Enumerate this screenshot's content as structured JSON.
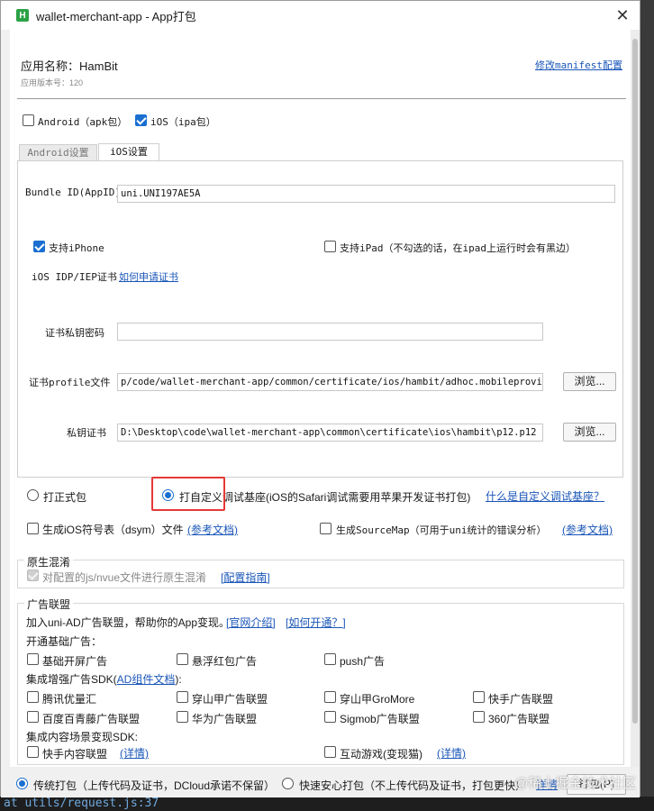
{
  "window": {
    "title": "wallet-merchant-app - App打包",
    "logo": "H"
  },
  "app": {
    "name_label": "应用名称：HamBit",
    "version_label": "应用版本号：120",
    "edit_manifest": "修改manifest配置"
  },
  "platforms": {
    "android": {
      "label": "Android（apk包）",
      "checked": false
    },
    "ios": {
      "label": "iOS（ipa包）",
      "checked": true
    }
  },
  "tabs": [
    "Android设置",
    "iOS设置"
  ],
  "ios": {
    "bundle_label": "Bundle ID(AppID)",
    "bundle_value": "uni.UNI197AE5A",
    "support_iphone": "支持iPhone",
    "support_ipad": "支持iPad（不勾选的话，在ipad上运行时会有黑边）",
    "cert_label": "iOS IDP/IEP证书",
    "cert_link": "如何申请证书",
    "password_label": "证书私钥密码",
    "password_value": "",
    "profile_label": "证书profile文件",
    "profile_value": "p/code/wallet-merchant-app/common/certificate/ios/hambit/adhoc.mobileprovision",
    "key_label": "私钥证书",
    "key_value": "D:\\Desktop\\code\\wallet-merchant-app\\common\\certificate\\ios\\hambit\\p12.p12",
    "browse": "浏览..."
  },
  "package_type": {
    "formal": "打正式包",
    "custom": "打自定义调试基座(iOS的Safari调试需要用苹果开发证书打包)",
    "custom_help": "什么是自定义调试基座？"
  },
  "options": {
    "dsym": "生成iOS符号表（dsym）文件",
    "dsym_doc": "(参考文档)",
    "sourcemap": "生成SourceMap（可用于uni统计的错误分析）",
    "sourcemap_doc": "(参考文档)"
  },
  "obfuscation": {
    "title": "原生混淆",
    "label": "对配置的js/nvue文件进行原生混淆",
    "guide": "[配置指南]"
  },
  "ads": {
    "title": "广告联盟",
    "intro": "加入uni-AD广告联盟，帮助你的App变现。",
    "intro_link1": "[官网介绍]",
    "intro_link2": "[如何开通？]",
    "basic_title": "开通基础广告：",
    "basic": [
      "基础开屏广告",
      "悬浮红包广告",
      "push广告"
    ],
    "sdk_title_prefix": "集成增强广告SDK(",
    "sdk_title_link": "AD组件文档",
    "sdk_title_suffix": "):",
    "sdk_row1": [
      "腾讯优量汇",
      "穿山甲广告联盟",
      "穿山甲GroMore",
      "快手广告联盟"
    ],
    "sdk_row2": [
      "百度百青藤广告联盟",
      "华为广告联盟",
      "Sigmob广告联盟",
      "360广告联盟"
    ],
    "content_title": "集成内容场景变现SDK:",
    "content1": "快手内容联盟",
    "content1_link": "(详情)",
    "content2": "互动游戏(变现猫)",
    "content2_link": "(详情)"
  },
  "footer": {
    "traditional": "传统打包（上传代码及证书，DCloud承诺不保留）",
    "safe": "快速安心打包（不上传代码及证书，打包更快）",
    "details": "详情",
    "pack_button": "打包(P)"
  },
  "background": {
    "code_line": "at utils/request.js:37"
  },
  "watermark": "@稀土掘金技术社区"
}
